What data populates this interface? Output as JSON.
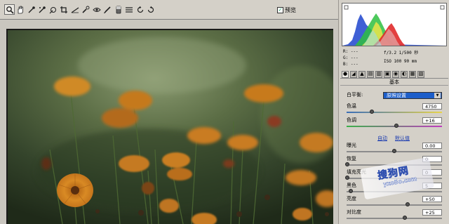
{
  "toolbar": {
    "tools": [
      {
        "name": "zoom-tool",
        "icon": "magnifier-icon"
      },
      {
        "name": "hand-tool",
        "icon": "hand-icon"
      },
      {
        "name": "white-balance-tool",
        "icon": "eyedropper-icon"
      },
      {
        "name": "color-sampler-tool",
        "icon": "sampler-icon"
      },
      {
        "name": "targeted-adjustment-tool",
        "icon": "target-icon"
      },
      {
        "name": "crop-tool",
        "icon": "crop-icon"
      },
      {
        "name": "straighten-tool",
        "icon": "straighten-icon"
      },
      {
        "name": "spot-removal-tool",
        "icon": "spot-icon"
      },
      {
        "name": "red-eye-tool",
        "icon": "red-eye-icon"
      },
      {
        "name": "adjustment-brush-tool",
        "icon": "brush-icon"
      },
      {
        "name": "graduated-filter-tool",
        "icon": "gradient-icon"
      },
      {
        "name": "preferences-tool",
        "icon": "list-icon"
      },
      {
        "name": "rotate-left-tool",
        "icon": "rotate-ccw-icon"
      },
      {
        "name": "rotate-right-tool",
        "icon": "rotate-cw-icon"
      }
    ],
    "preview_label": "预览",
    "preview_checked": true
  },
  "readout": {
    "r": "R:  ---",
    "g": "G:  ---",
    "b": "B:  ---",
    "exposure": "f/3.2  1/500 秒",
    "iso": "ISO 100   90 mm"
  },
  "panel": {
    "section_title": "基本",
    "wb_label": "白平衡:",
    "wb_value": "原照设置",
    "temp_label": "色温",
    "temp_value": "4750",
    "tint_label": "色调",
    "tint_value": "+16",
    "auto_link": "自动",
    "default_link": "默认值",
    "exposure_label": "曝光",
    "exposure_value": "0.00",
    "recovery_label": "恢复",
    "recovery_value": "0",
    "fill_label": "填充亮光",
    "fill_value": "0",
    "blacks_label": "黑色",
    "blacks_value": "5",
    "brightness_label": "亮度",
    "brightness_value": "+50",
    "contrast_label": "对比度",
    "contrast_value": "+25"
  },
  "watermark": {
    "text": "搜狗网",
    "sub": "yxo5o.com"
  },
  "colors": {
    "selection": "#1d5ec9",
    "link": "#1b3bb0"
  }
}
